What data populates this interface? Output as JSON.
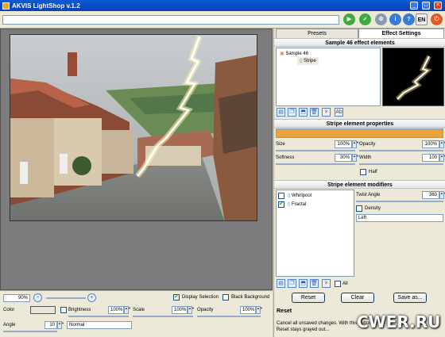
{
  "window": {
    "title": "AKVIS LightShop v.1.2"
  },
  "toolbar": {
    "url": "",
    "lang": "EN"
  },
  "zoom": {
    "value": "90%",
    "display_selection": "Display Selection",
    "black_background": "Black Background"
  },
  "bottom": {
    "color_label": "Color",
    "brightness_label": "Brightness",
    "brightness_value": "100%",
    "scale_label": "Scale",
    "scale_value": "100%",
    "opacity_label": "Opacity",
    "opacity_value": "100%",
    "angle_label": "Angle",
    "angle_value": "10",
    "blend_mode": "Normal"
  },
  "tabs": {
    "presets": "Presets",
    "effect_settings": "Effect Settings"
  },
  "elements": {
    "header": "Sample 46 effect elements",
    "root": "Sample 46",
    "child": "Stripe"
  },
  "props": {
    "header": "Stripe element properties",
    "size_label": "Size",
    "size_value": "100%",
    "opacity_label": "Opacity",
    "opacity_value": "100%",
    "softness_label": "Softness",
    "softness_value": "30%",
    "width_label": "Width",
    "width_value": "100",
    "half_label": "Half"
  },
  "modifiers": {
    "header": "Stripe element modifiers",
    "items": [
      {
        "label": "Whirlpool",
        "checked": false
      },
      {
        "label": "Fractal",
        "checked": true
      }
    ],
    "twist_label": "Twist Angle",
    "twist_value": "360",
    "density_label": "Density",
    "direction": "Left",
    "all_label": "All"
  },
  "actions": {
    "reset": "Reset",
    "clear": "Clear",
    "save_as": "Save as..."
  },
  "help": {
    "title": "Reset",
    "text": "Cancel all unsaved changes. With this button Reset stays grayed out..."
  },
  "watermark": "CWER.RU",
  "colors": {
    "accent": "#e8a33a",
    "title_blue": "#0a5ad8"
  }
}
